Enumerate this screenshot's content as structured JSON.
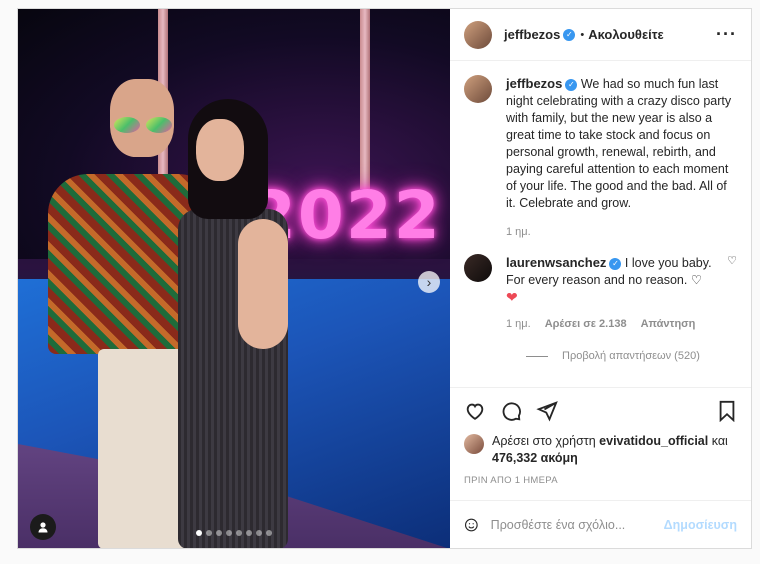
{
  "header": {
    "username": "jeffbezos",
    "separator": "•",
    "follow_label": "Ακολουθείτε",
    "more_label": "···"
  },
  "media": {
    "sign_text": "2022",
    "next_glyph": "›",
    "carousel_count": 8,
    "carousel_active": 1
  },
  "caption": {
    "username": "jeffbezos",
    "text": "We had so much fun last night celebrating with a crazy disco party with family, but the new year is also a great time to take stock and focus on personal growth, renewal, rebirth, and paying careful attention to each moment of your life. The good and the bad. All of it. Celebrate and grow.",
    "time": "1 ημ."
  },
  "comment": {
    "username": "laurenwsanchez",
    "text": "I love you baby. For every reason and no reason. ♡",
    "emoji": "❤",
    "time": "1 ημ.",
    "likes": "Αρέσει σε 2.138",
    "reply": "Απάντηση",
    "view_replies": "Προβολή απαντήσεων (520)"
  },
  "likes": {
    "prefix": "Αρέσει στο χρήστη",
    "user": "evivatidou_official",
    "conj": "και",
    "count": "476,332 ακόμη"
  },
  "timestamp": "ΠΡΙΝ ΑΠΟ 1 ΗΜΕΡΑ",
  "comment_box": {
    "placeholder": "Προσθέστε ένα σχόλιο...",
    "post_label": "Δημοσίευση"
  },
  "colors": {
    "verified": "#3897f0",
    "post_disabled": "#b3dbff",
    "like_red": "#ed4956"
  }
}
